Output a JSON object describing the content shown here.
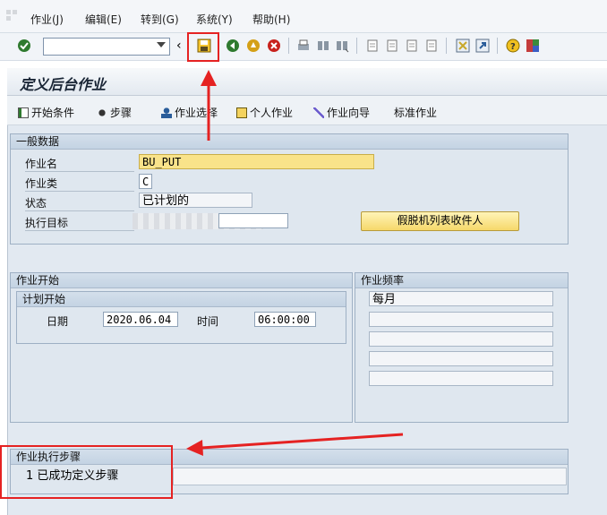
{
  "menu": [
    {
      "label": "作业(J)"
    },
    {
      "label": "编辑(E)"
    },
    {
      "label": "转到(G)"
    },
    {
      "label": "系统(Y)"
    },
    {
      "label": "帮助(H)"
    }
  ],
  "toolbar": {
    "icons": [
      "enter-icon",
      "command-field",
      "save-icon",
      "back-icon",
      "exit-icon",
      "cancel-icon",
      "print-icon",
      "find-icon",
      "find-next-icon",
      "first-page-icon",
      "prev-page-icon",
      "next-page-icon",
      "last-page-icon",
      "new-session-icon",
      "shortcut-icon",
      "help-icon",
      "layout-icon"
    ]
  },
  "page": {
    "title": "定义后台作业"
  },
  "app_toolbar": [
    {
      "label": "开始条件"
    },
    {
      "label": "步骤"
    },
    {
      "label": "作业选择"
    },
    {
      "label": "个人作业"
    },
    {
      "label": "作业向导"
    },
    {
      "label": "标准作业"
    }
  ],
  "general": {
    "header": "一般数据",
    "job_name_label": "作业名",
    "job_name_value": "BU_PUT",
    "job_class_label": "作业类",
    "job_class_value": "C",
    "status_label": "状态",
    "status_value": "已计划的",
    "exec_target_label": "执行目标",
    "exec_target_value": "",
    "spool_button": "假脱机列表收件人"
  },
  "job_start": {
    "header": "作业开始",
    "planned_header": "计划开始",
    "date_label": "日期",
    "date_value": "2020.06.04",
    "time_label": "时间",
    "time_value": "06:00:00"
  },
  "frequency": {
    "header": "作业频率",
    "rows": [
      "每月",
      "",
      "",
      "",
      ""
    ]
  },
  "steps": {
    "header": "作业执行步骤",
    "text": "1 已成功定义步骤"
  },
  "colors": {
    "annotation": "#e52222",
    "panel_bg": "#e2e9f1"
  }
}
